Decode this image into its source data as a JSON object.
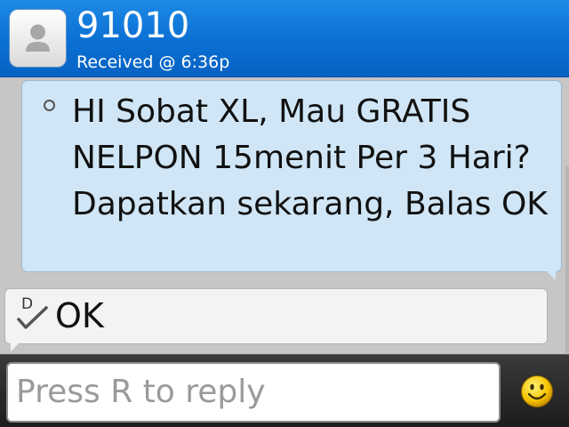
{
  "header": {
    "contact_name": "91010",
    "received": "Received @ 6:36p",
    "avatar_icon": "contact-silhouette-icon"
  },
  "messages": {
    "incoming": {
      "text": "HI Sobat XL, Mau GRATIS NELPON 15menit Per 3 Hari? Dapatkan sekarang, Balas OK",
      "bullet_icon": "unread-circle-icon"
    },
    "outgoing": {
      "text": "OK",
      "status_letter": "D",
      "status_icon": "delivered-check-icon"
    }
  },
  "reply": {
    "placeholder": "Press R to reply",
    "emoticon_icon": "smiley-icon"
  },
  "colors": {
    "header_blue": "#0a6fd2",
    "incoming_bubble": "#d0e6f6",
    "outgoing_bubble": "#f3f3f3",
    "background": "#c6c6c6"
  }
}
